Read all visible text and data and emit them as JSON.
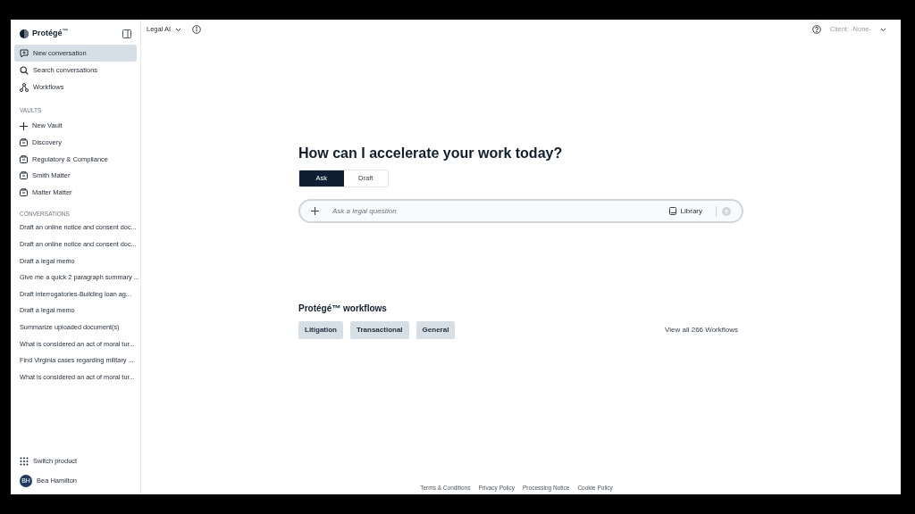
{
  "sidebar": {
    "logo": "Protégé$^{™}$",
    "nav": [
      {
        "label": "New conversation",
        "kind": "new",
        "selected": true
      },
      {
        "label": "Search conversations",
        "kind": "search",
        "selected": false
      },
      {
        "label": "Workflows",
        "kind": "workflows",
        "selected": false
      }
    ],
    "vaults_heading": "VAULTS",
    "vaults": [
      {
        "label": "New Vault",
        "kind": "add"
      },
      {
        "label": "Discovery",
        "kind": "vault"
      },
      {
        "label": "Regulatory & Compliance",
        "kind": "vault"
      },
      {
        "label": "Smith Matter",
        "kind": "vault"
      },
      {
        "label": "Matter Matter",
        "kind": "vault"
      }
    ],
    "conversations_heading": "CONVERSATIONS",
    "conversations": [
      "Draft an online notice and consent doc...",
      "Draft an online notice and consent doc...",
      "Draft a legal memo",
      "Give me a quick 2 paragraph summary ...",
      "Draft interrogatories-Building loan ag...",
      "Draft a legal memo",
      "Summarize uploaded document(s)",
      "What is considered an act of moral tur...",
      "Find Virginia cases regarding military ...",
      "What is considered an act of moral tur..."
    ],
    "switch_product": "Switch product",
    "user": {
      "initials": "BH",
      "name": "Bea Hamilton"
    }
  },
  "header": {
    "model": "Legal AI",
    "client": "Client: -None-"
  },
  "main": {
    "heading": "How can I accelerate your work today?",
    "modes": [
      {
        "label": "Ask",
        "selected": true
      },
      {
        "label": "Draft",
        "selected": false
      }
    ],
    "input": {
      "placeholder": "Ask a legal question",
      "library": "Library"
    },
    "workflows_heading": "Protégé™ workflows",
    "workflow_chips": [
      "Litigation",
      "Transactional",
      "General"
    ],
    "view_all": "View all 266 Workflows"
  },
  "footer": [
    "Terms & Conditions",
    "Privacy Policy",
    "Processing Notice",
    "Cookie Policy"
  ]
}
